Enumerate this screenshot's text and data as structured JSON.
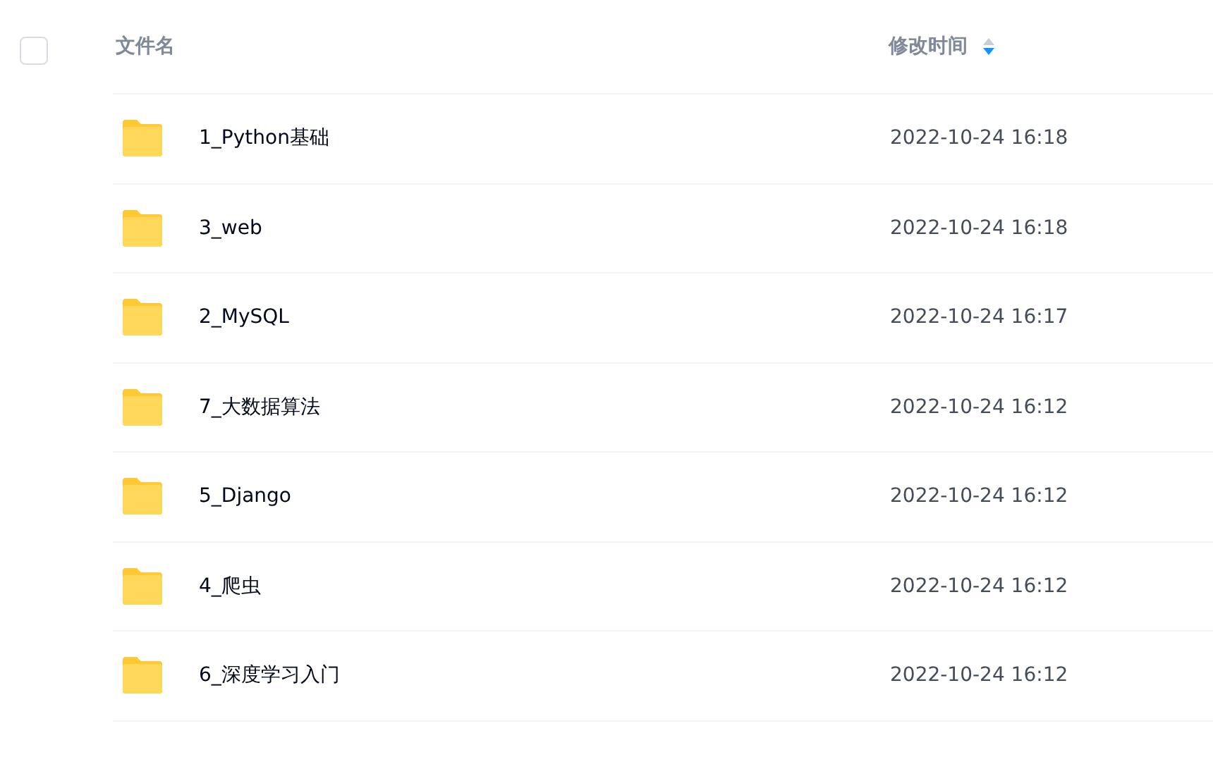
{
  "header": {
    "select_all": {
      "checked": false
    },
    "columns": [
      {
        "label": "文件名"
      },
      {
        "label": "修改时间",
        "sorted_descending": true
      }
    ]
  },
  "rows": [
    {
      "name": "1_Python基础",
      "modified": "2022-10-24 16:18"
    },
    {
      "name": "3_web",
      "modified": "2022-10-24 16:18"
    },
    {
      "name": "2_MySQL",
      "modified": "2022-10-24 16:17"
    },
    {
      "name": "7_大数据算法",
      "modified": "2022-10-24 16:12"
    },
    {
      "name": "5_Django",
      "modified": "2022-10-24 16:12"
    },
    {
      "name": "4_爬虫",
      "modified": "2022-10-24 16:12"
    },
    {
      "name": "6_深度学习入门",
      "modified": "2022-10-24 16:12"
    }
  ]
}
